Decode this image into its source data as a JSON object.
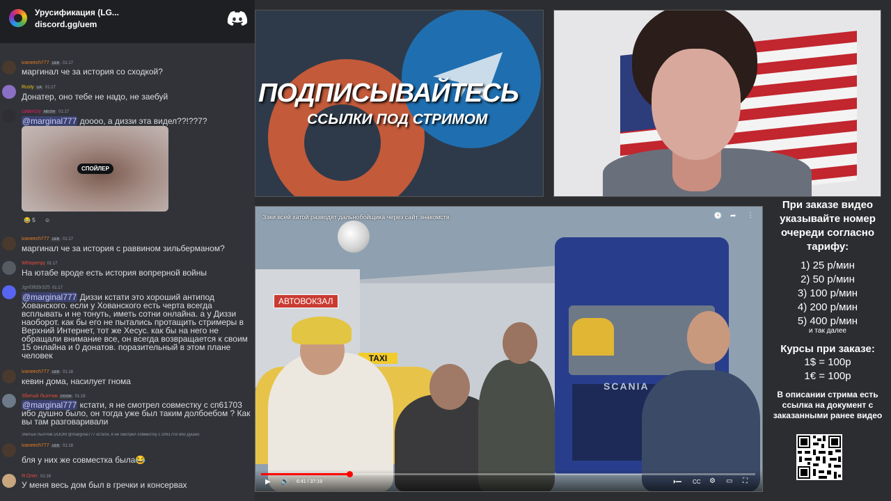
{
  "discord": {
    "server_name": "Урусификация (LG...",
    "invite": "discord.gg/uem",
    "spoiler_label": "СПОЙЛЕР",
    "spoiler_reaction_count": "5",
    "messages": [
      {
        "user": "ivaneech777",
        "badge": "UEB",
        "time": "01:17",
        "text": "маргинал че за история со сходкой?"
      },
      {
        "user": "Rusty",
        "badge": "UA",
        "time": "01:17",
        "text": "Донатер, оно тебе не надо, не заебуй"
      },
      {
        "user": "calam1ty",
        "badge": "MEOW",
        "time": "01:17",
        "mention": "@marginal777",
        "text": " доооо, а диззи эта видел??!??7?"
      },
      {
        "user": "ivaneech777",
        "badge": "UEB",
        "time": "01:17",
        "text": "маргинал че за история с раввином зильберманом?"
      },
      {
        "user": "Whisperqq",
        "badge": "",
        "time": "01:17",
        "text": "На ютабе вроде есть история вопрерной войны"
      },
      {
        "user": "Jgnf3fd3r325",
        "badge": "",
        "time": "01:17",
        "mention": "@marginal777",
        "text": " Диззи кстати это хороший антипод Хованского. если у Хованского есть черта всегда всплывать и не тонуть, иметь сотни онлайна. а у Диззи наоборот. как бы его не пытались протащить стримеры в Верхний Интернет, тот же Хесус. как бы на него не обращали внимание все, он всегда возвращается к своим 15 онлайна и 0 донатов. поразительный в этом плане человек"
      },
      {
        "user": "ivaneech777",
        "badge": "UEB",
        "time": "01:18",
        "text": "кевин дома, насилует гнома"
      },
      {
        "user": "Збитый Льотчик",
        "badge": "DOOM",
        "time": "01:18",
        "mention": "@marginal777",
        "text": " кстати, я не смотрел совместку с сп61703 ибо душно было, он тогда уже был таким долбоебом ? Как вы там разговаривали"
      },
      {
        "user": "ivaneech777",
        "badge": "UEB",
        "time": "01:18",
        "text": "бля у них же совместка была😂"
      },
      {
        "user": "Я Олег.",
        "badge": "",
        "time": "01:18",
        "text": "У меня весь дом был в гречки и консервах"
      }
    ],
    "reply_preview": "Збитый Льотчик  DOOM  @marginal777 кстати, я не смотрел совместку с сп61703 ибо душно"
  },
  "promo": {
    "title": "ПОДПИСЫВАЙТЕСЬ",
    "subtitle": "ССЫЛКИ ПОД СТРИМОМ"
  },
  "player": {
    "video_title": "Зэки всей хатой разводят дальнобойщика через сайт знакомств.",
    "station_sign": "АВТОВОКЗАЛ",
    "taxi_sign": "TAXI",
    "truck_brand": "SCANIA",
    "time": "6:41 / 37:19",
    "progress": 0.179,
    "icons": [
      "clock-icon",
      "share-icon",
      "more-icon",
      "play-icon",
      "volume-icon",
      "cc-icon",
      "settings-icon",
      "cast-icon",
      "fullscreen-icon"
    ]
  },
  "info": {
    "heading": "При заказе видео указывайте номер очереди согласно тарифу:",
    "tariffs": [
      "1) 25 р/мин",
      "2) 50 р/мин",
      "3) 100 р/мин",
      "4) 200 р/мин",
      "5) 400 р/мин"
    ],
    "tariff_more": "и так далее",
    "rates_heading": "Курсы при заказе:",
    "rates": [
      "1$ = 100р",
      "1€ = 100р"
    ],
    "description": "В описании стрима есть ссылка на документ с заказанными ранее видео"
  },
  "colors": {
    "discord_bg": "#313338",
    "accent_red": "#ff0000",
    "telegram_blue": "#1f6fb0",
    "promo_red": "#c35a3a"
  }
}
